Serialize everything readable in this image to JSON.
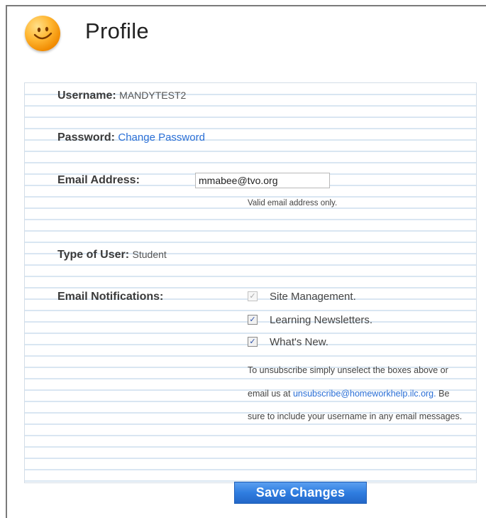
{
  "header": {
    "title": "Profile",
    "icon": "smiley-face-icon"
  },
  "profile": {
    "username_label": "Username:",
    "username_value": "MANDYTEST2",
    "password_label": "Password:",
    "password_link": "Change Password",
    "email_label": "Email Address:",
    "email_value": "mmabee@tvo.org",
    "email_hint": "Valid email address only.",
    "user_type_label": "Type of User:",
    "user_type_value": "Student",
    "notifications_label": "Email Notifications:",
    "notifications": [
      {
        "label": "Site Management.",
        "checked": true,
        "disabled": true
      },
      {
        "label": "Learning Newsletters.",
        "checked": true,
        "disabled": false
      },
      {
        "label": "What's New.",
        "checked": true,
        "disabled": false
      }
    ],
    "unsubscribe_text_1": "To unsubscribe simply unselect the boxes above or email us at",
    "unsubscribe_email": "unsubscribe@homeworkhelp.ilc.org.",
    "unsubscribe_text_2": "Be sure to include your username in any email messages."
  },
  "actions": {
    "save_label": "Save Changes"
  },
  "colors": {
    "accent": "#2f7de0",
    "link": "#2a6fd6",
    "rule": "#d9e6f2"
  }
}
